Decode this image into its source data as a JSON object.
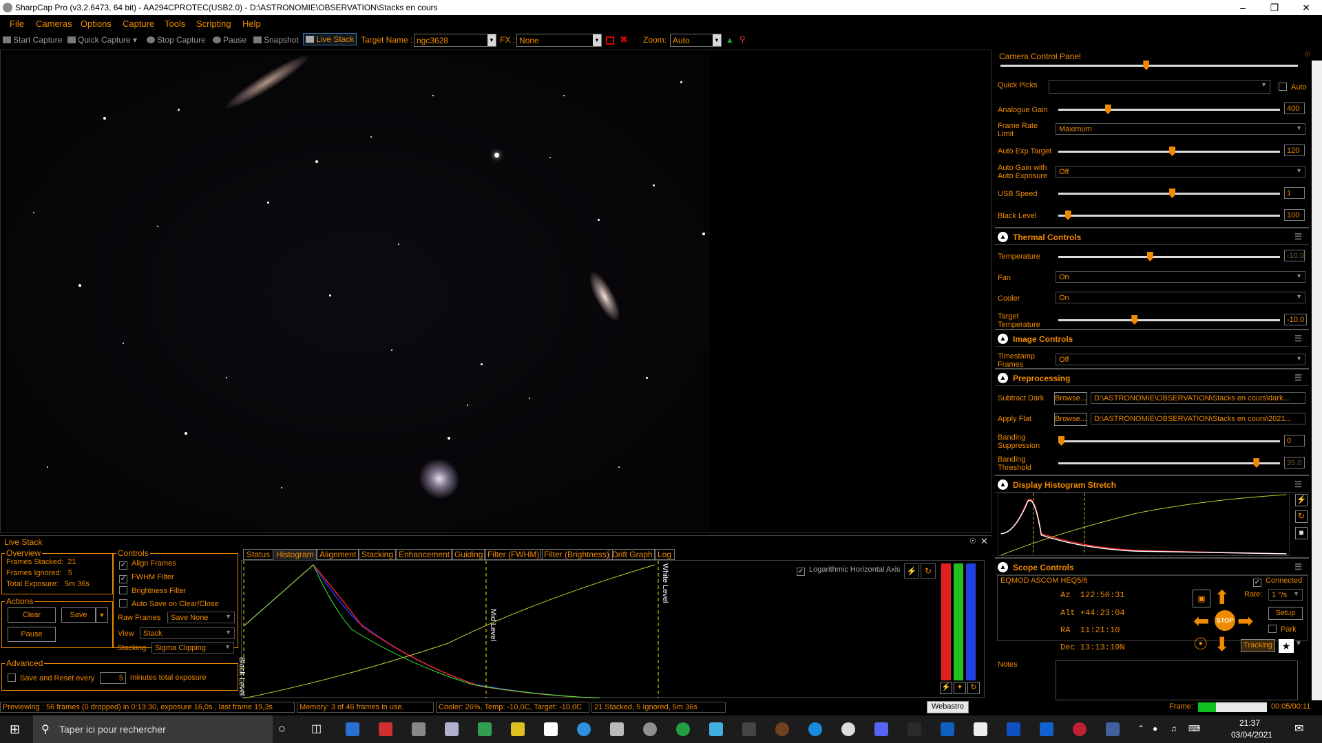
{
  "window": {
    "title": "SharpCap Pro (v3.2.6473, 64 bit) - AA294CPROTEC(USB2.0) - D:\\ASTRONOMIE\\OBSERVATION\\Stacks en cours"
  },
  "menu": [
    "File",
    "Cameras",
    "Options",
    "Capture",
    "Tools",
    "Scripting",
    "Help"
  ],
  "toolbar": {
    "start_capture": "Start Capture",
    "quick_capture": "Quick Capture",
    "stop_capture": "Stop Capture",
    "pause": "Pause",
    "snapshot": "Snapshot",
    "live_stack": "Live Stack",
    "target_label": "Target Name :",
    "target_value": "ngc3628",
    "fx_label": "FX :",
    "fx_value": "None",
    "zoom_label": "Zoom:",
    "zoom_value": "Auto"
  },
  "camera_panel": {
    "title": "Camera Control Panel",
    "quick_picks": "Quick Picks",
    "auto": "Auto",
    "analogue_gain": {
      "label": "Analogue Gain",
      "value": "400",
      "level": 0.21
    },
    "frame_rate": {
      "label": "Frame Rate Limit",
      "value": "Maximum"
    },
    "auto_exp": {
      "label": "Auto Exp Target",
      "value": "120",
      "level": 0.5
    },
    "auto_gain": {
      "label": "Auto Gain with Auto Exposure",
      "value": "Off"
    },
    "usb_speed": {
      "label": "USB Speed",
      "value": "1",
      "level": 0.5
    },
    "black_level": {
      "label": "Black Level",
      "value": "100",
      "level": 0.05
    }
  },
  "thermal": {
    "title": "Thermal Controls",
    "temperature": {
      "label": "Temperature",
      "value": "-10.0",
      "level": 0.4
    },
    "fan": {
      "label": "Fan",
      "value": "On"
    },
    "cooler": {
      "label": "Cooler",
      "value": "On"
    },
    "target_temp": {
      "label": "Target Temperature",
      "value": "-10.0",
      "level": 0.33
    }
  },
  "image_controls": {
    "title": "Image Controls",
    "timestamp": {
      "label": "Timestamp Frames",
      "value": "Off"
    }
  },
  "preprocessing": {
    "title": "Preprocessing",
    "subtract_dark": {
      "label": "Subtract Dark",
      "button": "Browse...",
      "path": "D:\\ASTRONOMIE\\OBSERVATION\\Stacks en cours\\dark..."
    },
    "apply_flat": {
      "label": "Apply Flat",
      "button": "Browse...",
      "path": "D:\\ASTRONOMIE\\OBSERVATION\\Stacks en cours\\2021..."
    },
    "banding_sup": {
      "label": "Banding Suppression",
      "value": "0",
      "level": 0.0
    },
    "banding_thr": {
      "label": "Banding Threshold",
      "value": "35.0",
      "level": 0.88
    }
  },
  "histogram_stretch": {
    "title": "Display Histogram Stretch"
  },
  "scope": {
    "title": "Scope Controls",
    "mount": "EQMOD ASCOM HEQ5/6",
    "connected": "Connected",
    "az": "Az  122:50:31",
    "alt": "Alt +44:23:04",
    "ra": "RA  11:21:10",
    "dec": "Dec 13:13:19N",
    "rate_label": "Rate:",
    "rate_value": "1 °/s",
    "setup": "Setup",
    "park": "Park",
    "tracking": "Tracking",
    "stop": "STOP"
  },
  "notes": "Notes",
  "livestack": {
    "title": "Live Stack",
    "overview": "Overview",
    "frames_stacked": "Frames Stacked:  21",
    "frames_ignored": "Frames Ignored:   5",
    "total_exposure": "Total Exposure:   5m 36s",
    "actions": "Actions",
    "clear": "Clear",
    "save": "Save",
    "pause": "Pause",
    "advanced": "Advanced",
    "save_reset": "Save and Reset every",
    "minutes_value": "5",
    "minutes_label": "minutes total exposure",
    "controls": "Controls",
    "align": "Align Frames",
    "fwhm": "FWHM Filter",
    "brightness": "Brightness Filter",
    "autosave": "Auto Save on Clear/Close",
    "raw_frames_label": "Raw Frames",
    "raw_frames_value": "Save None",
    "view_label": "View",
    "view_value": "Stack",
    "stacking_label": "Stacking",
    "stacking_value": "Sigma Clipping",
    "tabs": [
      "Status",
      "Histogram",
      "Alignment",
      "Stacking",
      "Enhancement",
      "Guiding",
      "Filter (FWHM)",
      "Filter (Brightness)",
      "Drift Graph",
      "Log"
    ],
    "log_axis": "Logarithmic Horizontal Axis",
    "black_level": "Black Level",
    "mid_level": "Mid Level",
    "white_level": "White Level"
  },
  "status": {
    "preview": "Previewing : 56 frames (0 dropped) in 0:13:30, exposure 16,0s , last frame 19,3s",
    "memory": "Memory: 3 of 46 frames in use.",
    "cooler": "Cooler: 26%, Temp: -10,0C, Target: -10,0C",
    "stacked": "21 Stacked, 5 Ignored, 5m 36s",
    "frame_label": "Frame:",
    "frame_time": "00:05/00:11",
    "tooltip": "Webastro"
  },
  "taskbar": {
    "search": "Taper ici pour rechercher",
    "time": "21:37",
    "date": "03/04/2021"
  }
}
